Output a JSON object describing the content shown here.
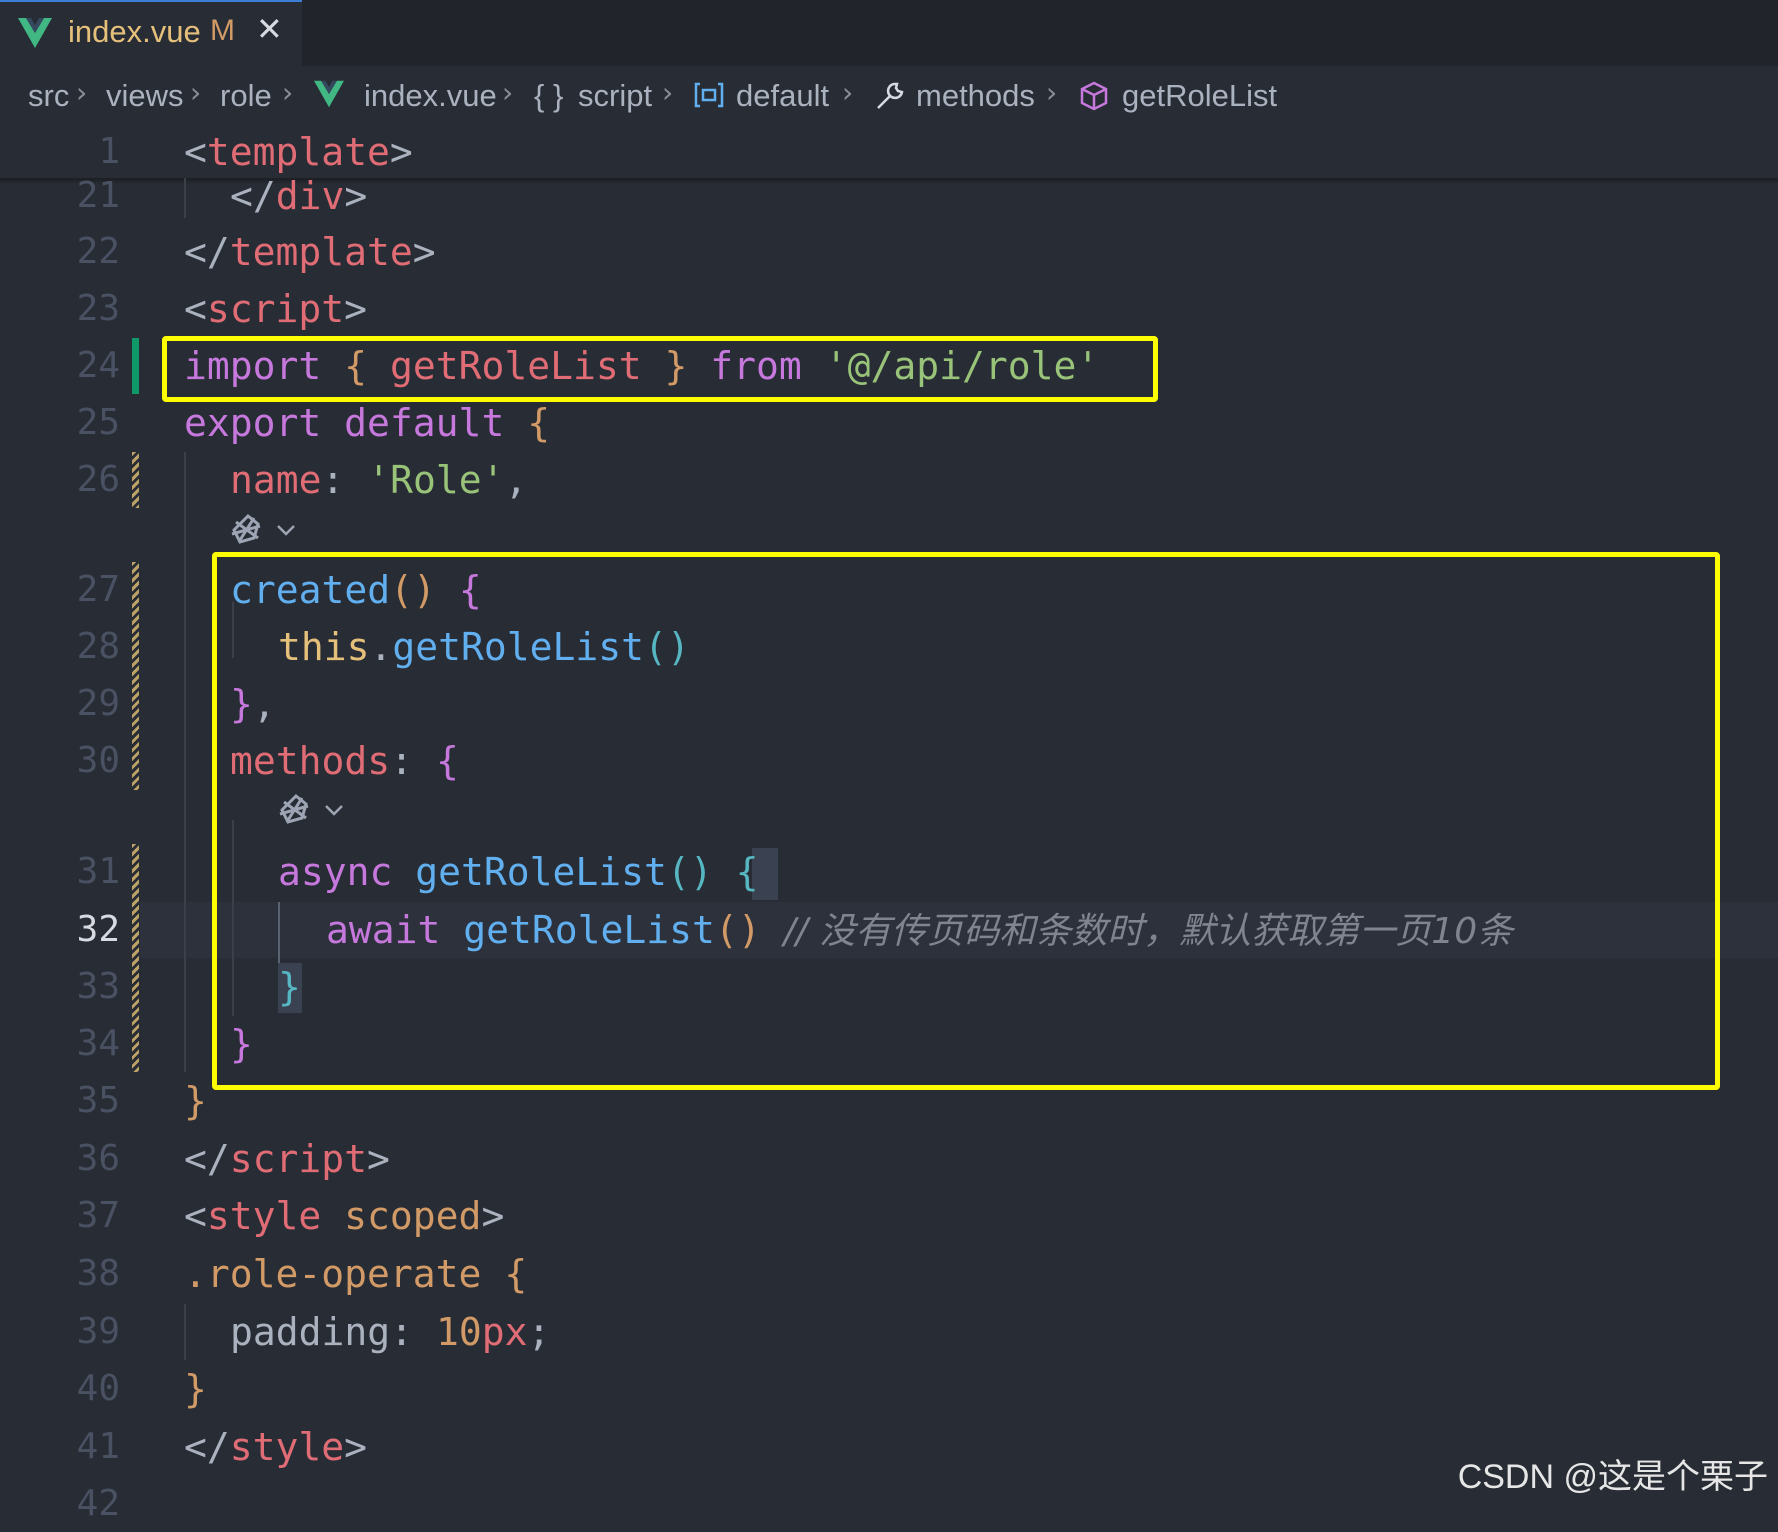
{
  "tab": {
    "filename": "index.vue",
    "status": "M",
    "close": "✕"
  },
  "breadcrumb": {
    "items": [
      "src",
      "views",
      "role",
      "index.vue",
      "script",
      "default",
      "methods",
      "getRoleList"
    ],
    "separator": "›",
    "script_braces": "{ }"
  },
  "code": {
    "lines": [
      {
        "num": "1"
      },
      {
        "num": "21"
      },
      {
        "num": "22"
      },
      {
        "num": "23"
      },
      {
        "num": "24"
      },
      {
        "num": "25"
      },
      {
        "num": "26"
      },
      {
        "num": "27"
      },
      {
        "num": "28"
      },
      {
        "num": "29"
      },
      {
        "num": "30"
      },
      {
        "num": "31"
      },
      {
        "num": "32"
      },
      {
        "num": "33"
      },
      {
        "num": "34"
      },
      {
        "num": "35"
      },
      {
        "num": "36"
      },
      {
        "num": "37"
      },
      {
        "num": "38"
      },
      {
        "num": "39"
      },
      {
        "num": "40"
      },
      {
        "num": "41"
      },
      {
        "num": "42"
      }
    ],
    "t1": {
      "lt": "<",
      "tag": "template",
      "gt": ">"
    },
    "t21": {
      "lt": "</",
      "tag": "div",
      "gt": ">"
    },
    "t22": {
      "lt": "</",
      "tag": "template",
      "gt": ">"
    },
    "t23": {
      "lt": "<",
      "tag": "script",
      "gt": ">"
    },
    "t24": {
      "kw": "import",
      "ob": "{",
      "name": "getRoleList",
      "cb": "}",
      "from": "from",
      "str": "'@/api/role'"
    },
    "t25": {
      "kw": "export",
      "kw2": "default",
      "ob": "{"
    },
    "t26": {
      "prop": "name",
      "colon": ":",
      "str": "'Role'",
      "comma": ","
    },
    "t27": {
      "fn": "created",
      "paren": "()",
      "ob": "{"
    },
    "t28": {
      "this": "this",
      "dot": ".",
      "fn": "getRoleList",
      "paren": "()"
    },
    "t29": {
      "cb": "}",
      "comma": ","
    },
    "t30": {
      "prop": "methods",
      "colon": ":",
      "ob": "{"
    },
    "t31": {
      "kw": "async",
      "fn": "getRoleList",
      "paren": "()",
      "ob": "{"
    },
    "t32": {
      "kw": "await",
      "fn": "getRoleList",
      "paren": "()",
      "comment": "// 没有传页码和条数时，默认获取第一页10条"
    },
    "t33": {
      "cb": "}"
    },
    "t34": {
      "cb": "}"
    },
    "t35": {
      "cb": "}"
    },
    "t36": {
      "lt": "</",
      "tag": "script",
      "gt": ">"
    },
    "t37": {
      "lt": "<",
      "tag": "style",
      "attr": "scoped",
      "gt": ">"
    },
    "t38": {
      "sel": ".role-operate",
      "ob": "{"
    },
    "t39": {
      "prop": "padding",
      "colon": ":",
      "num": "10",
      "unit": "px",
      "semi": ";"
    },
    "t40": {
      "cb": "}"
    },
    "t41": {
      "lt": "</",
      "tag": "style",
      "gt": ">"
    }
  },
  "watermark": "CSDN @这是个栗子",
  "colors": {
    "highlight_box": "#ffff00",
    "diff_added": "#109868",
    "editor_bg": "#282c34"
  }
}
